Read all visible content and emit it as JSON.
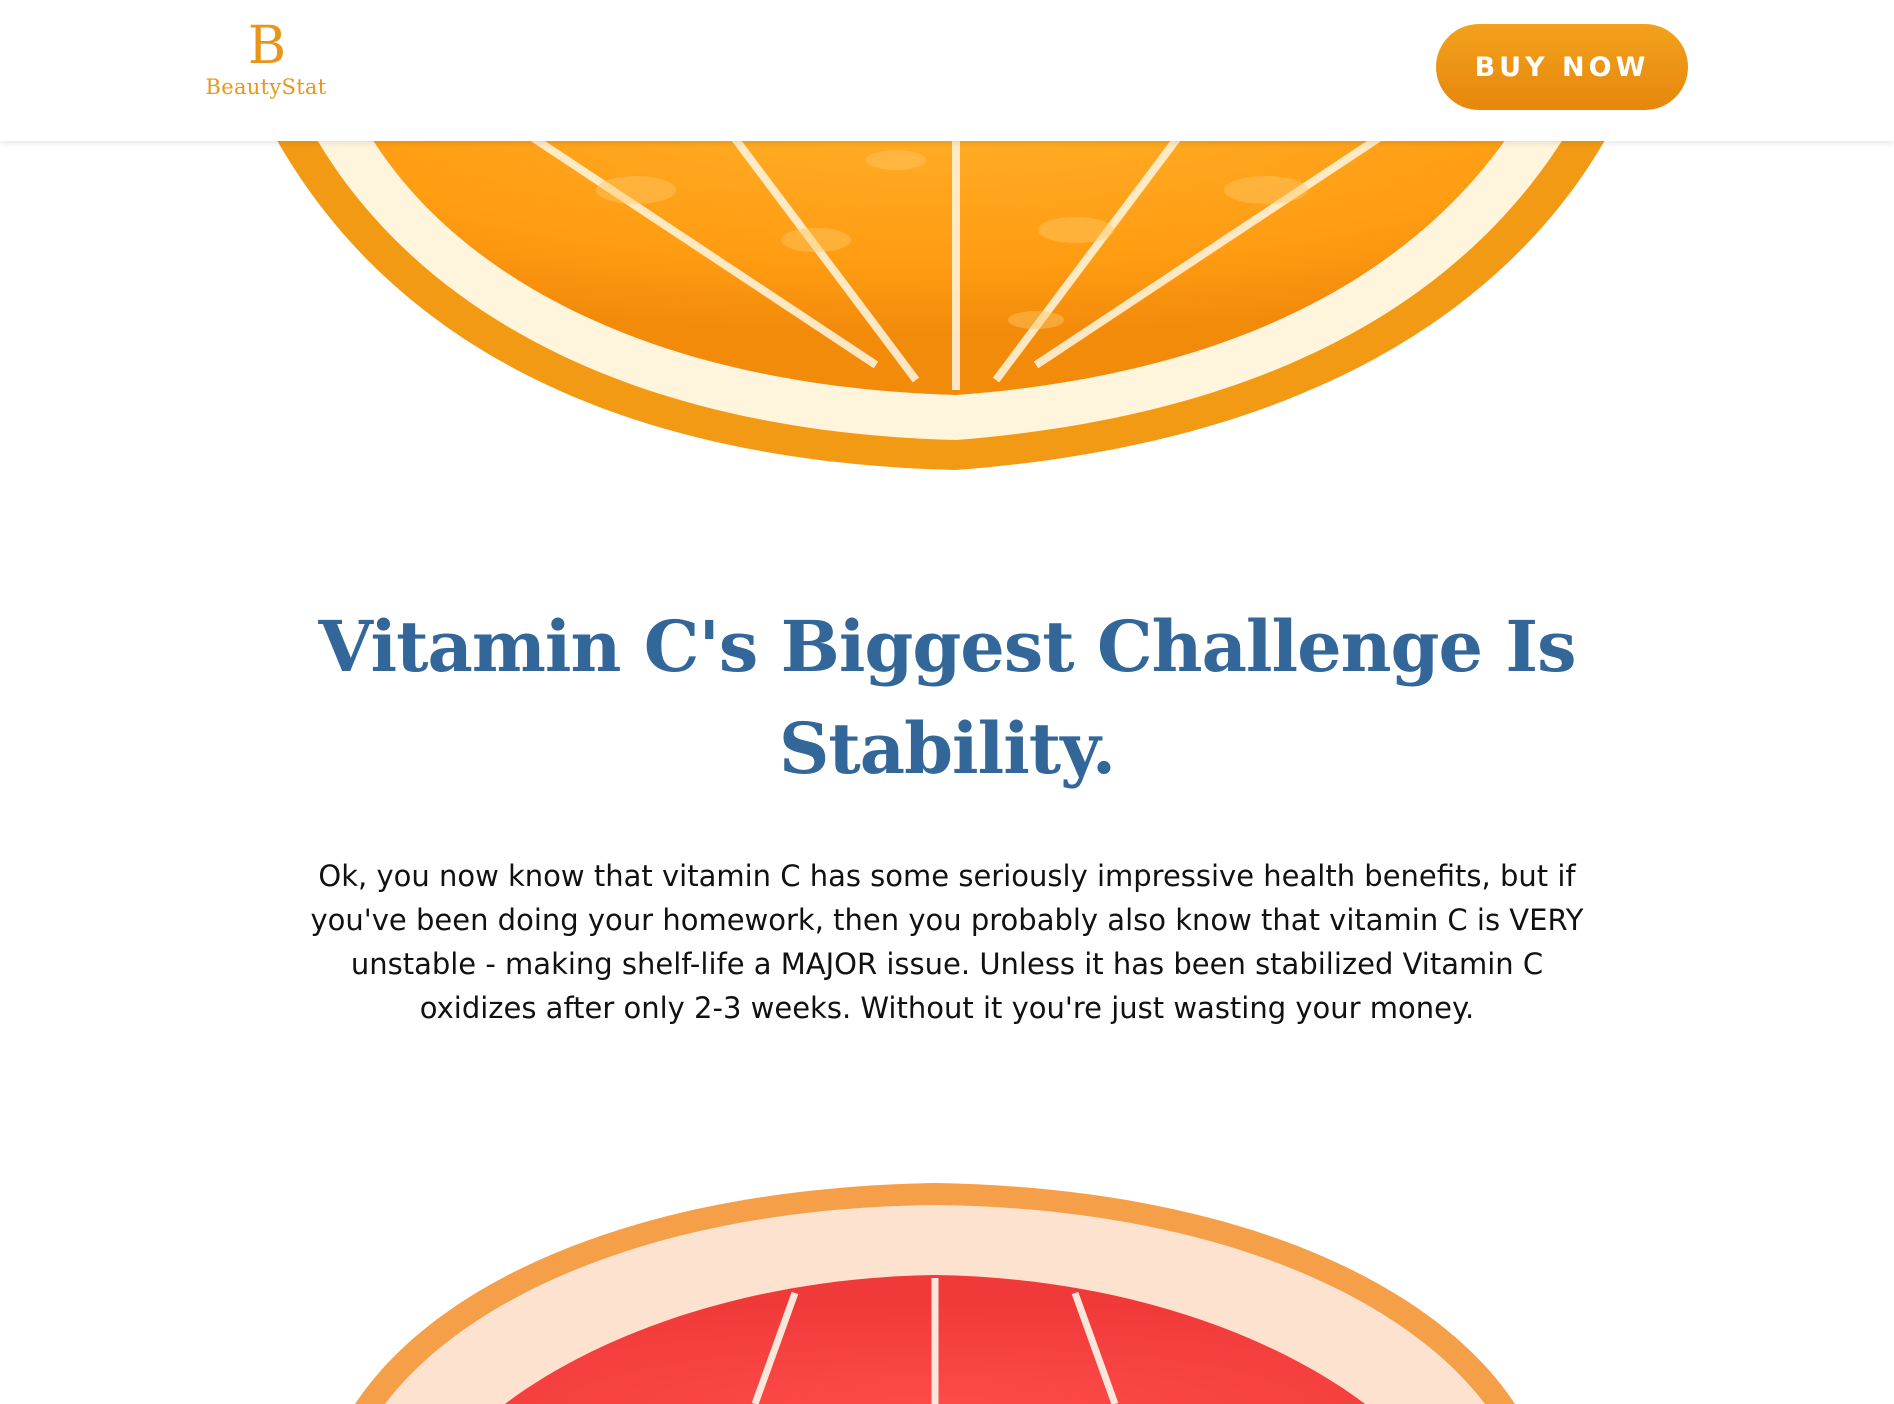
{
  "header": {
    "logo": {
      "mark": "B",
      "name": "BeautyStat"
    },
    "buy_button_label": "BUY NOW"
  },
  "colors": {
    "brand_orange": "#e8951a",
    "button_orange": "#ef9613",
    "headline_blue": "#336699",
    "body_text": "#111111",
    "background": "#ffffff"
  },
  "main": {
    "headline": "Vitamin C's Biggest Challenge Is Stability.",
    "body": "Ok, you now know that vitamin C has some seriously impressive health benefits, but if you've been doing your homework, then you probably also know that vitamin C is VERY unstable - making shelf-life a MAJOR issue. Unless it has been stabilized Vitamin C oxidizes after only 2-3 weeks. Without it you're just wasting your money."
  },
  "images": {
    "top": "orange-slice",
    "bottom": "grapefruit-slice"
  }
}
